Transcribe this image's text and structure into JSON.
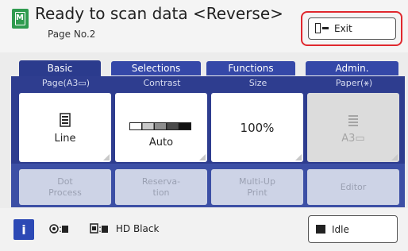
{
  "header": {
    "title": "Ready to scan data <Reverse>",
    "page": "Page No.2",
    "exit_label": "Exit"
  },
  "tabs": [
    {
      "label": "Basic",
      "active": true
    },
    {
      "label": "Selections"
    },
    {
      "label": "Functions"
    },
    {
      "label": "Admin."
    }
  ],
  "columns": [
    {
      "label": "Page(A3▭)",
      "value": "Line",
      "icon": "original-page-icon"
    },
    {
      "label": "Contrast",
      "value": "Auto",
      "icon": "contrast-scale-icon"
    },
    {
      "label": "Size",
      "value": "100%"
    },
    {
      "label": "Paper(⚹)",
      "value": "A3▭",
      "icon": "paper-tray-icon",
      "disabled": true
    }
  ],
  "secondary": [
    {
      "label": "Dot\nProcess"
    },
    {
      "label": "Reserva-\ntion"
    },
    {
      "label": "Multi-Up\nPrint"
    },
    {
      "label": "Editor"
    }
  ],
  "status": {
    "info": "i",
    "indicator1": ":",
    "indicator2": ":",
    "drum": "HD Black",
    "idle_label": "Idle"
  },
  "colors": {
    "accent": "#2e3d8f",
    "highlight": "#e0282e",
    "scan_icon": "#2f9b4f"
  }
}
